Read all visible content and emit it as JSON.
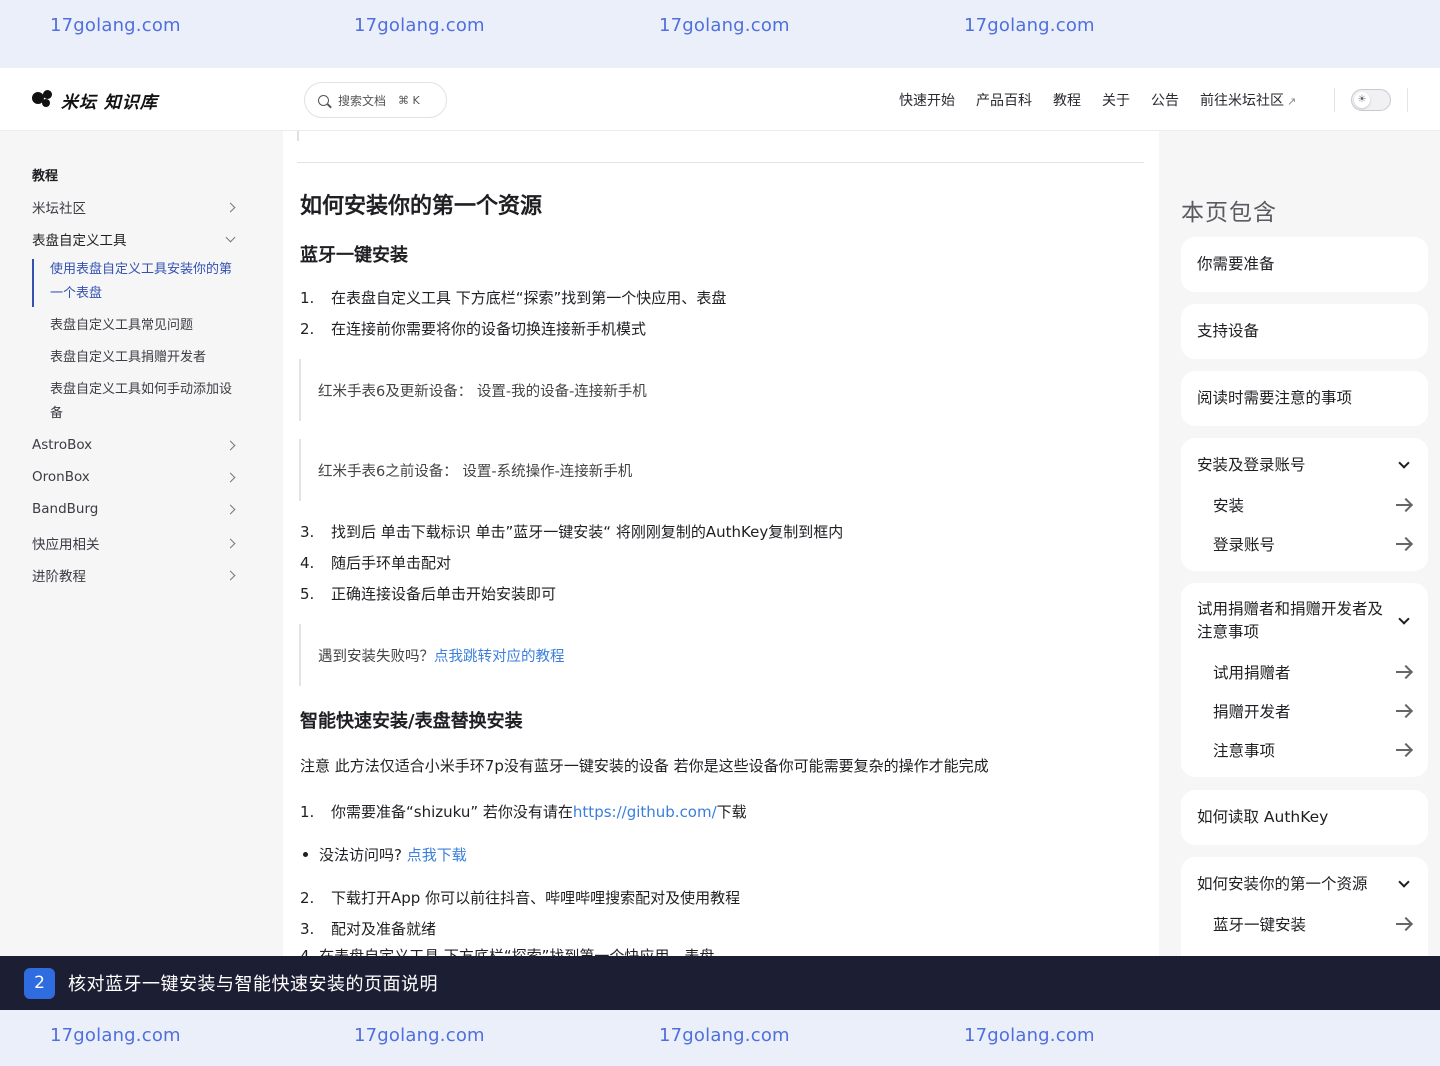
{
  "watermark": {
    "text": "17golang.com"
  },
  "header": {
    "logo_text": "米坛 知识库",
    "search_placeholder": "搜索文档",
    "search_shortcut": "⌘ K",
    "nav": [
      "快速开始",
      "产品百科",
      "教程",
      "关于",
      "公告",
      "前往米坛社区"
    ],
    "external_mark": "↗",
    "theme_toggle_icon": "sun-icon"
  },
  "sidebar": {
    "heading": "教程",
    "items": [
      {
        "label": "米坛社区"
      },
      {
        "label": "表盘自定义工具"
      },
      {
        "label": "AstroBox"
      },
      {
        "label": "OronBox"
      },
      {
        "label": "BandBurg"
      },
      {
        "label": "快应用相关"
      },
      {
        "label": "进阶教程"
      }
    ],
    "subitems": [
      {
        "label": "使用表盘自定义工具安装你的第一个表盘"
      },
      {
        "label": "表盘自定义工具常见问题"
      },
      {
        "label": "表盘自定义工具捐赠开发者"
      },
      {
        "label": "表盘自定义工具如何手动添加设备"
      }
    ]
  },
  "article": {
    "title": "如何安装你的第一个资源",
    "section1_title": "蓝牙一键安装",
    "steps1": [
      {
        "num": "1.",
        "text": "在表盘自定义工具 下方底栏“探索”找到第一个快应用、表盘"
      },
      {
        "num": "2.",
        "text": "在连接前你需要将你的设备切换连接新手机模式"
      }
    ],
    "quote1": "红米手表6及更新设备：  设置-我的设备-连接新手机",
    "quote2": "红米手表6之前设备：  设置-系统操作-连接新手机",
    "steps2": [
      {
        "num": "3.",
        "text": "找到后 单击下载标识 单击”蓝牙一键安装“ 将刚刚复制的AuthKey复制到框内"
      },
      {
        "num": "4.",
        "text": "随后手环单击配对"
      },
      {
        "num": "5.",
        "text": "正确连接设备后单击开始安装即可"
      }
    ],
    "fail_prefix": "遇到安装失败吗？",
    "fail_link": "点我跳转对应的教程",
    "section2_title": "智能快速安装/表盘替换安装",
    "note": "注意 此方法仅适合小米手环7p没有蓝牙一键安装的设备 若你是这些设备你可能需要复杂的操作才能完成",
    "step_s1_num": "1.",
    "step_s1_text": "你需要准备“shizuku” 若你没有请在",
    "step_s1_link": "https://github.com/",
    "step_s1_suffix": "下载",
    "bullet_prefix": "没法访问吗?",
    "bullet_link": "点我下载",
    "steps3": [
      {
        "num": "2.",
        "text": "下载打开App 你可以前往抖音、哔哩哔哩搜索配对及使用教程"
      },
      {
        "num": "3.",
        "text": "配对及准备就绪"
      }
    ],
    "cut_text": "4. 在表盘自定义工具 下方底栏“探索”找到第一个快应用、表盘"
  },
  "toc": {
    "title": "本页包含",
    "cards": [
      {
        "label": "你需要准备"
      },
      {
        "label": "支持设备"
      },
      {
        "label": "阅读时需要注意的事项"
      },
      {
        "label": "安装及登录账号",
        "children": [
          "安装",
          "登录账号"
        ]
      },
      {
        "label": "试用捐赠者和捐赠开发者及注意事项",
        "children": [
          "试用捐赠者",
          "捐赠开发者",
          "注意事项"
        ]
      },
      {
        "label": "如何读取 AuthKey"
      },
      {
        "label": "如何安装你的第一个资源",
        "children": [
          "蓝牙一键安装"
        ]
      }
    ]
  },
  "caption": {
    "badge": "2",
    "text": "核对蓝牙一键安装与智能快速安装的页面说明"
  },
  "colors": {
    "link": "#3a7fdd",
    "active": "#3451b2",
    "caption_bg": "#1c1f33",
    "badge_bg": "#2f6ce0",
    "watermark": "#4f6fdc"
  }
}
